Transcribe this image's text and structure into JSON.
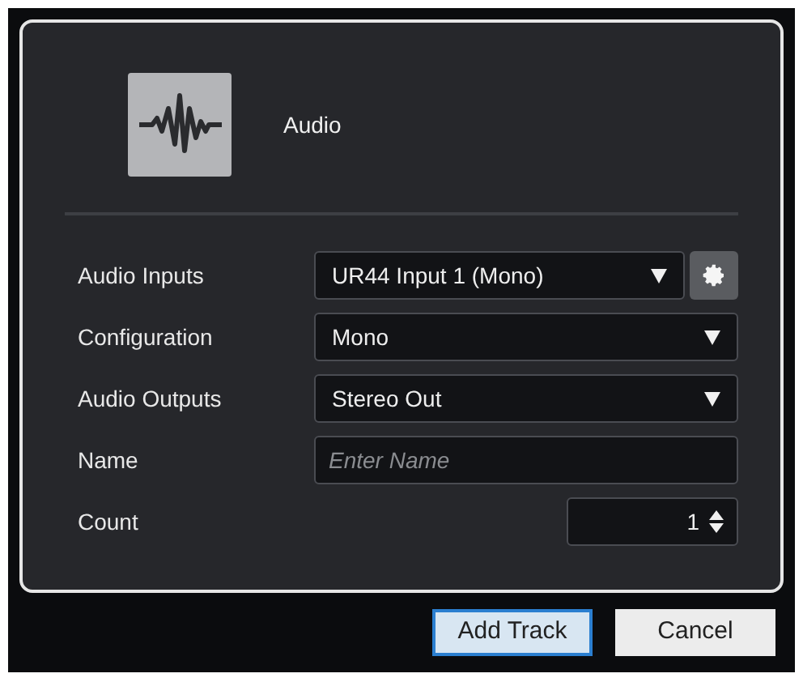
{
  "track_type": {
    "label": "Audio"
  },
  "fields": [
    {
      "label": "Audio Inputs",
      "kind": "dropdown",
      "value": "UR44 Input 1 (Mono)",
      "settings": true
    },
    {
      "label": "Configuration",
      "kind": "dropdown",
      "value": "Mono"
    },
    {
      "label": "Audio Outputs",
      "kind": "dropdown",
      "value": "Stereo Out"
    },
    {
      "label": "Name",
      "kind": "text",
      "placeholder": "Enter Name"
    },
    {
      "label": "Count",
      "kind": "number",
      "value": "1"
    }
  ],
  "buttons": [
    {
      "label": "Add Track",
      "default": true
    },
    {
      "label": "Cancel",
      "default": false
    }
  ]
}
